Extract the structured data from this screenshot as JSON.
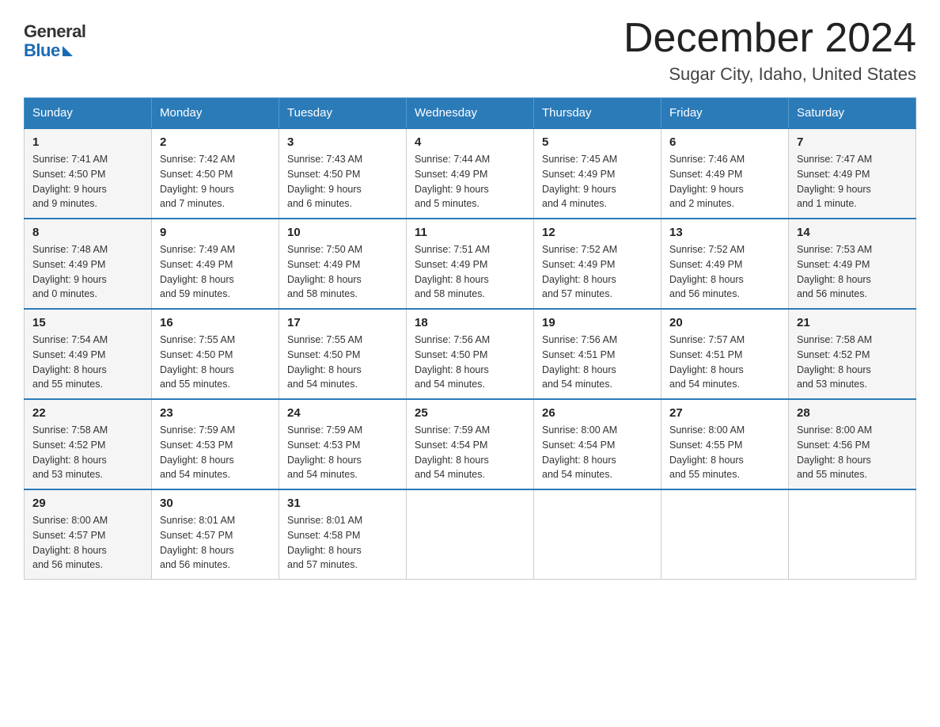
{
  "logo": {
    "general": "General",
    "blue": "Blue"
  },
  "title": "December 2024",
  "location": "Sugar City, Idaho, United States",
  "weekdays": [
    "Sunday",
    "Monday",
    "Tuesday",
    "Wednesday",
    "Thursday",
    "Friday",
    "Saturday"
  ],
  "weeks": [
    [
      {
        "day": "1",
        "sunrise": "7:41 AM",
        "sunset": "4:50 PM",
        "daylight": "9 hours and 9 minutes."
      },
      {
        "day": "2",
        "sunrise": "7:42 AM",
        "sunset": "4:50 PM",
        "daylight": "9 hours and 7 minutes."
      },
      {
        "day": "3",
        "sunrise": "7:43 AM",
        "sunset": "4:50 PM",
        "daylight": "9 hours and 6 minutes."
      },
      {
        "day": "4",
        "sunrise": "7:44 AM",
        "sunset": "4:49 PM",
        "daylight": "9 hours and 5 minutes."
      },
      {
        "day": "5",
        "sunrise": "7:45 AM",
        "sunset": "4:49 PM",
        "daylight": "9 hours and 4 minutes."
      },
      {
        "day": "6",
        "sunrise": "7:46 AM",
        "sunset": "4:49 PM",
        "daylight": "9 hours and 2 minutes."
      },
      {
        "day": "7",
        "sunrise": "7:47 AM",
        "sunset": "4:49 PM",
        "daylight": "9 hours and 1 minute."
      }
    ],
    [
      {
        "day": "8",
        "sunrise": "7:48 AM",
        "sunset": "4:49 PM",
        "daylight": "9 hours and 0 minutes."
      },
      {
        "day": "9",
        "sunrise": "7:49 AM",
        "sunset": "4:49 PM",
        "daylight": "8 hours and 59 minutes."
      },
      {
        "day": "10",
        "sunrise": "7:50 AM",
        "sunset": "4:49 PM",
        "daylight": "8 hours and 58 minutes."
      },
      {
        "day": "11",
        "sunrise": "7:51 AM",
        "sunset": "4:49 PM",
        "daylight": "8 hours and 58 minutes."
      },
      {
        "day": "12",
        "sunrise": "7:52 AM",
        "sunset": "4:49 PM",
        "daylight": "8 hours and 57 minutes."
      },
      {
        "day": "13",
        "sunrise": "7:52 AM",
        "sunset": "4:49 PM",
        "daylight": "8 hours and 56 minutes."
      },
      {
        "day": "14",
        "sunrise": "7:53 AM",
        "sunset": "4:49 PM",
        "daylight": "8 hours and 56 minutes."
      }
    ],
    [
      {
        "day": "15",
        "sunrise": "7:54 AM",
        "sunset": "4:49 PM",
        "daylight": "8 hours and 55 minutes."
      },
      {
        "day": "16",
        "sunrise": "7:55 AM",
        "sunset": "4:50 PM",
        "daylight": "8 hours and 55 minutes."
      },
      {
        "day": "17",
        "sunrise": "7:55 AM",
        "sunset": "4:50 PM",
        "daylight": "8 hours and 54 minutes."
      },
      {
        "day": "18",
        "sunrise": "7:56 AM",
        "sunset": "4:50 PM",
        "daylight": "8 hours and 54 minutes."
      },
      {
        "day": "19",
        "sunrise": "7:56 AM",
        "sunset": "4:51 PM",
        "daylight": "8 hours and 54 minutes."
      },
      {
        "day": "20",
        "sunrise": "7:57 AM",
        "sunset": "4:51 PM",
        "daylight": "8 hours and 54 minutes."
      },
      {
        "day": "21",
        "sunrise": "7:58 AM",
        "sunset": "4:52 PM",
        "daylight": "8 hours and 53 minutes."
      }
    ],
    [
      {
        "day": "22",
        "sunrise": "7:58 AM",
        "sunset": "4:52 PM",
        "daylight": "8 hours and 53 minutes."
      },
      {
        "day": "23",
        "sunrise": "7:59 AM",
        "sunset": "4:53 PM",
        "daylight": "8 hours and 54 minutes."
      },
      {
        "day": "24",
        "sunrise": "7:59 AM",
        "sunset": "4:53 PM",
        "daylight": "8 hours and 54 minutes."
      },
      {
        "day": "25",
        "sunrise": "7:59 AM",
        "sunset": "4:54 PM",
        "daylight": "8 hours and 54 minutes."
      },
      {
        "day": "26",
        "sunrise": "8:00 AM",
        "sunset": "4:54 PM",
        "daylight": "8 hours and 54 minutes."
      },
      {
        "day": "27",
        "sunrise": "8:00 AM",
        "sunset": "4:55 PM",
        "daylight": "8 hours and 55 minutes."
      },
      {
        "day": "28",
        "sunrise": "8:00 AM",
        "sunset": "4:56 PM",
        "daylight": "8 hours and 55 minutes."
      }
    ],
    [
      {
        "day": "29",
        "sunrise": "8:00 AM",
        "sunset": "4:57 PM",
        "daylight": "8 hours and 56 minutes."
      },
      {
        "day": "30",
        "sunrise": "8:01 AM",
        "sunset": "4:57 PM",
        "daylight": "8 hours and 56 minutes."
      },
      {
        "day": "31",
        "sunrise": "8:01 AM",
        "sunset": "4:58 PM",
        "daylight": "8 hours and 57 minutes."
      },
      null,
      null,
      null,
      null
    ]
  ],
  "labels": {
    "sunrise": "Sunrise:",
    "sunset": "Sunset:",
    "daylight": "Daylight:"
  }
}
